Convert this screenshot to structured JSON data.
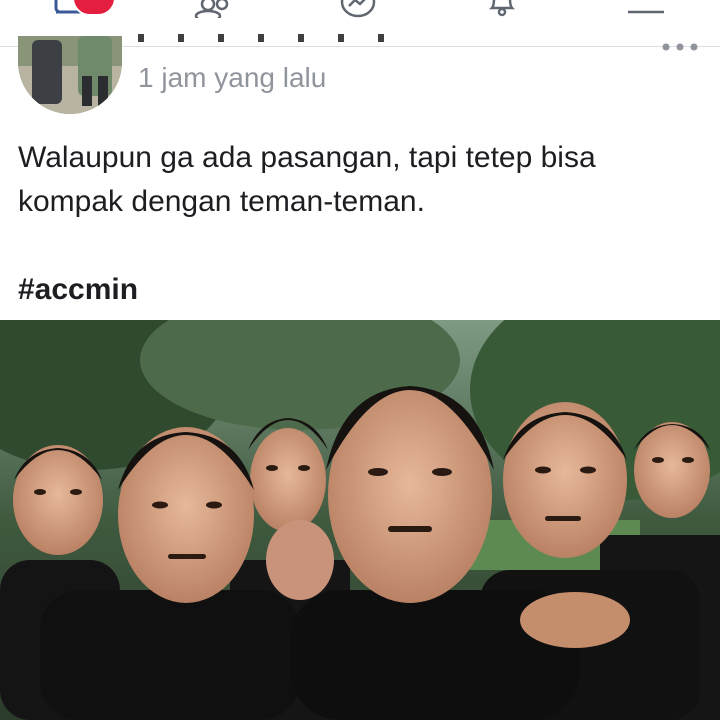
{
  "navbar": {
    "icons": [
      "home-icon",
      "friends-icon",
      "messenger-icon",
      "notifications-icon",
      "menu-icon"
    ],
    "accent_color": "#e41e3f"
  },
  "post": {
    "timestamp": "1 jam yang lalu",
    "text_line_1": "Walaupun ga ada pasangan, tapi tetep bisa",
    "text_line_2": "kompak dengan teman-teman.",
    "hashtag": "#accmin",
    "photo": "group-selfie-photo",
    "text_color": "#1c1e21",
    "timestamp_color": "#90949c"
  }
}
